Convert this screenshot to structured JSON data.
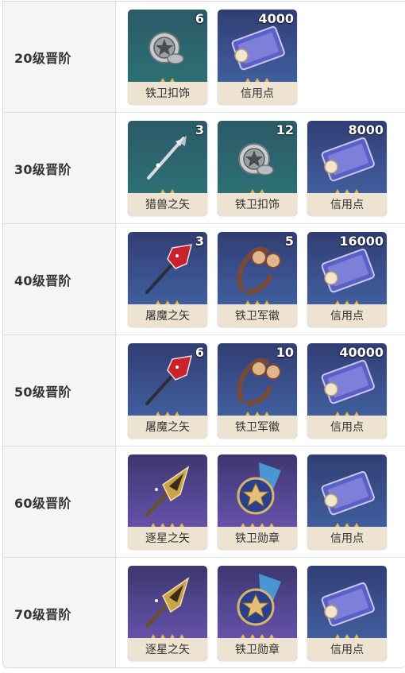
{
  "rows": [
    {
      "level": "20级晋阶",
      "items": [
        {
          "name": "铁卫扣饰",
          "qty": "6",
          "icon": "iron-guard-buckle-icon",
          "bg": "green"
        },
        {
          "name": "信用点",
          "qty": "4000",
          "icon": "credit-card-icon",
          "bg": "blue"
        }
      ]
    },
    {
      "level": "30级晋阶",
      "items": [
        {
          "name": "猎兽之矢",
          "qty": "3",
          "icon": "beast-hunter-arrow-icon",
          "bg": "green"
        },
        {
          "name": "铁卫扣饰",
          "qty": "12",
          "icon": "iron-guard-buckle-icon",
          "bg": "green"
        },
        {
          "name": "信用点",
          "qty": "8000",
          "icon": "credit-card-icon",
          "bg": "blue"
        }
      ]
    },
    {
      "level": "40级晋阶",
      "items": [
        {
          "name": "屠魔之矢",
          "qty": "3",
          "icon": "demon-slayer-arrow-icon",
          "bg": "blue"
        },
        {
          "name": "铁卫军徽",
          "qty": "5",
          "icon": "iron-guard-insignia-icon",
          "bg": "blue"
        },
        {
          "name": "信用点",
          "qty": "16000",
          "icon": "credit-card-icon",
          "bg": "blue"
        }
      ]
    },
    {
      "level": "50级晋阶",
      "items": [
        {
          "name": "屠魔之矢",
          "qty": "6",
          "icon": "demon-slayer-arrow-icon",
          "bg": "blue"
        },
        {
          "name": "铁卫军徽",
          "qty": "10",
          "icon": "iron-guard-insignia-icon",
          "bg": "blue"
        },
        {
          "name": "信用点",
          "qty": "40000",
          "icon": "credit-card-icon",
          "bg": "blue"
        }
      ]
    },
    {
      "level": "60级晋阶",
      "items": [
        {
          "name": "逐星之矢",
          "qty": "",
          "icon": "star-chaser-arrow-icon",
          "bg": "purple"
        },
        {
          "name": "铁卫勋章",
          "qty": "",
          "icon": "iron-guard-medal-icon",
          "bg": "purple"
        },
        {
          "name": "信用点",
          "qty": "",
          "icon": "credit-card-icon",
          "bg": "blue"
        }
      ]
    },
    {
      "level": "70级晋阶",
      "items": [
        {
          "name": "逐星之矢",
          "qty": "",
          "icon": "star-chaser-arrow-icon",
          "bg": "purple"
        },
        {
          "name": "铁卫勋章",
          "qty": "",
          "icon": "iron-guard-medal-icon",
          "bg": "purple"
        },
        {
          "name": "信用点",
          "qty": "",
          "icon": "credit-card-icon",
          "bg": "blue"
        }
      ]
    }
  ],
  "colors": {
    "label_bg": "#f5f5f5",
    "name_bg": "#ede3d0",
    "star": "#e6b84a",
    "green_bg": "#2c6b72",
    "blue_bg": "#3d5593",
    "purple_bg": "#5a4a9a"
  }
}
